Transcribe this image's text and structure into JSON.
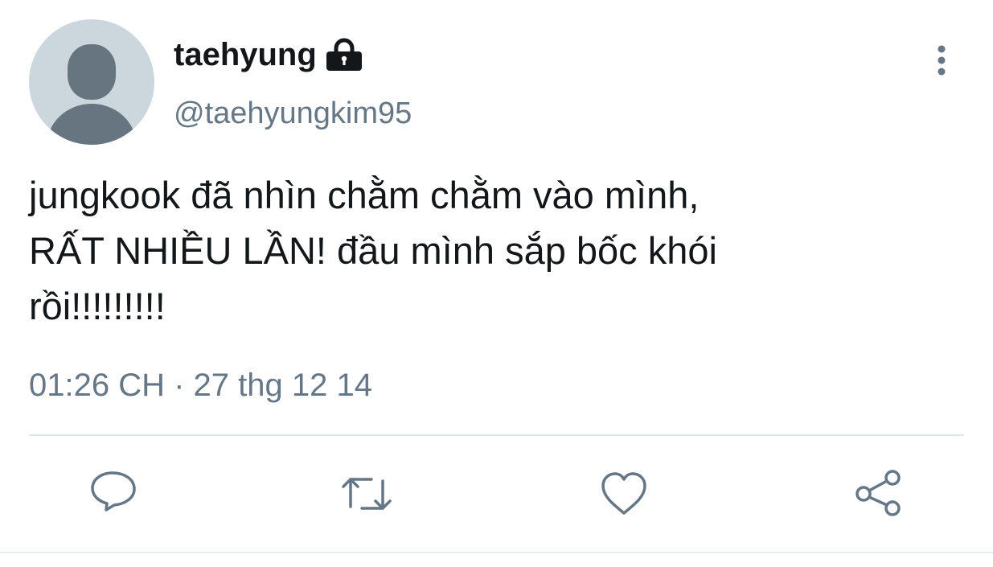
{
  "user": {
    "display_name": "taehyung",
    "handle": "@taehyungkim95",
    "protected_icon": "lock-icon",
    "avatar": "default-avatar"
  },
  "tweet": {
    "text": "jungkook đã nhìn chằm chằm vào mình,\nRẤT NHIỀU LẦN! đầu mình sắp bốc khói\nrồi!!!!!!!!!",
    "timestamp": "01:26 CH · 27 thg 12 14"
  },
  "actions": {
    "reply_icon": "reply-icon",
    "retweet_icon": "retweet-icon",
    "like_icon": "heart-icon",
    "share_icon": "share-icon",
    "more_icon": "more-vertical-icon"
  },
  "colors": {
    "text_primary": "#14171a",
    "text_secondary": "#657786",
    "avatar_bg": "#ccd6dd",
    "avatar_fg": "#66757f",
    "divider": "#e1e8ed"
  }
}
